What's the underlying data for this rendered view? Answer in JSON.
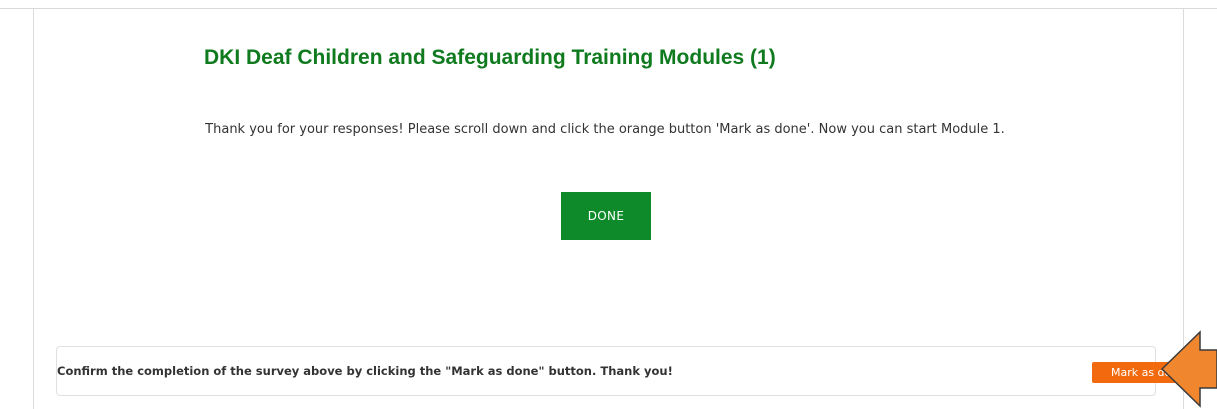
{
  "header_cut_text": "                                                                                           ",
  "survey": {
    "title": "DKI Deaf Children and Safeguarding Training Modules (1)",
    "message": "Thank you for your responses! Please scroll down and click the orange button 'Mark as done'. Now you can start Module 1.",
    "done_label": "DONE"
  },
  "confirmation": {
    "text": "Confirm the completion of the survey above by clicking the \"Mark as done\" button. Thank you!",
    "button_label": "Mark as done"
  },
  "colors": {
    "title_green": "#0f7a1e",
    "done_green": "#0f8a2a",
    "mark_done_orange": "#f26a0d",
    "arrow_orange": "#f0872e"
  },
  "icons": {
    "annotation_arrow": "left-pointing-arrow-icon"
  }
}
